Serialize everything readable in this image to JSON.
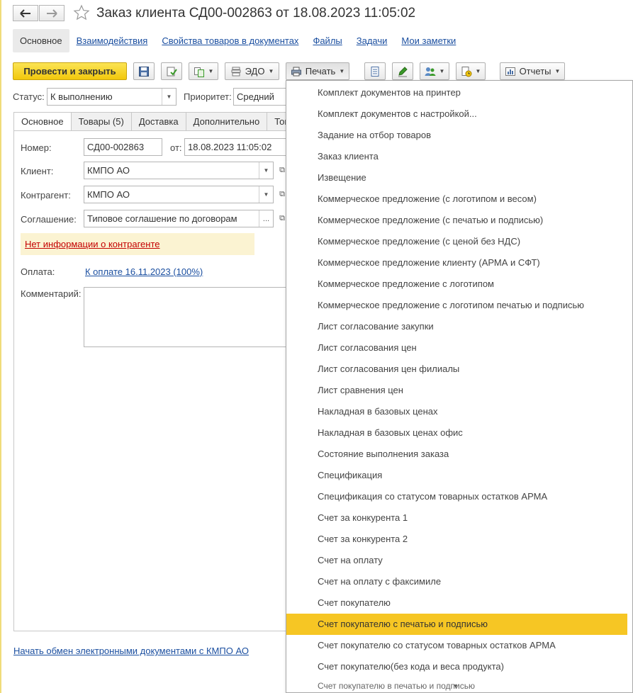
{
  "window": {
    "title": "Заказ клиента СД00-002863 от 18.08.2023 11:05:02"
  },
  "top_tabs": [
    {
      "label": "Основное"
    },
    {
      "label": "Взаимодействия"
    },
    {
      "label": "Свойства товаров в документах"
    },
    {
      "label": "Файлы"
    },
    {
      "label": "Задачи"
    },
    {
      "label": "Мои заметки"
    }
  ],
  "toolbar": {
    "post_close_label": "Провести и закрыть",
    "edo_label": "ЭДО",
    "print_label": "Печать",
    "reports_label": "Отчеты"
  },
  "status": {
    "label": "Статус:",
    "value": "К выполнению"
  },
  "priority": {
    "label": "Приоритет:",
    "value": "Средний"
  },
  "inner_tabs": [
    {
      "label": "Основное"
    },
    {
      "label": "Товары (5)"
    },
    {
      "label": "Доставка"
    },
    {
      "label": "Дополнительно"
    },
    {
      "label": "Това"
    }
  ],
  "form": {
    "number_label": "Номер:",
    "number_value": "СД00-002863",
    "date_label": "от:",
    "date_value": "18.08.2023 11:05:02",
    "client_label": "Клиент:",
    "client_value": "КМПО АО",
    "counterparty_label": "Контрагент:",
    "counterparty_value": "КМПО АО",
    "agreement_label": "Соглашение:",
    "agreement_value": "Типовое соглашение по договорам",
    "warning": "Нет информации о контрагенте",
    "payment_label": "Оплата:",
    "payment_link": "К оплате 16.11.2023 (100%)",
    "comment_label": "Комментарий:",
    "comment_value": ""
  },
  "footer": {
    "edo_link": "Начать обмен электронными документами с КМПО АО"
  },
  "print_menu": {
    "items": [
      "Комплект документов на принтер",
      "Комплект документов с настройкой...",
      "Задание на отбор товаров",
      "Заказ клиента",
      "Извещение",
      "Коммерческое предложение (с логотипом и весом)",
      "Коммерческое предложение (с печатью и подписью)",
      "Коммерческое предложение (с ценой без НДС)",
      "Коммерческое предложение клиенту (АРМА и СФТ)",
      "Коммерческое предложение с логотипом",
      "Коммерческое предложение с логотипом печатью и подписью",
      "Лист согласование закупки",
      "Лист согласования цен",
      "Лист согласования цен филиалы",
      "Лист сравнения цен",
      "Накладная в базовых ценах",
      "Накладная в базовых ценах офис",
      "Состояние выполнения заказа",
      "Спецификация",
      "Спецификация со статусом товарных остатков АРМА",
      "Счет за конкурента 1",
      "Счет за конкурента 2",
      "Счет на оплату",
      "Счет на оплату с факсимиле",
      "Счет покупателю",
      "Счет покупателю с печатью и подписью",
      "Счет покупателю со статусом товарных остатков АРМА",
      "Счет покупателю(без кода и веса продукта)"
    ],
    "highlighted_index": 25,
    "partial_item": "Счет покупателю в печатью и подписью"
  },
  "colors": {
    "accent": "#f6c624",
    "link": "#1b4fa0",
    "warning": "#c40000"
  }
}
